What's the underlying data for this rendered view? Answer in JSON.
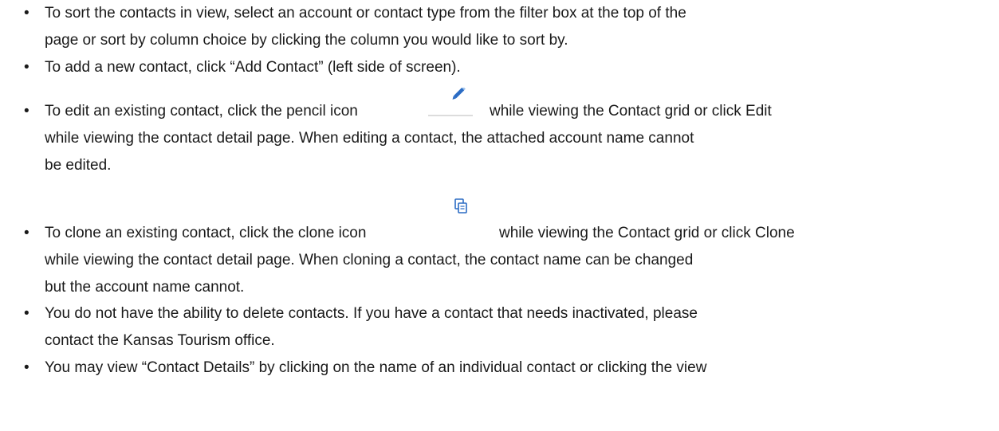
{
  "bullet_glyph": "•",
  "items": [
    {
      "lines": [
        "To sort the contacts in view, select an account or contact type from the filter box at the top of the",
        "page or sort by column choice by clicking the column you would like to sort by."
      ]
    },
    {
      "lines": [
        "To add a new contact, click “Add Contact” (left side of screen)."
      ]
    },
    {
      "lines": [
        "To edit an existing contact, click the pencil icon",
        "while viewing the Contact grid or click Edit",
        "while viewing the contact detail page. When editing a contact, the attached account name cannot",
        "be edited."
      ],
      "icon": "pencil-icon"
    },
    {
      "lines": [
        "To clone an existing contact, click the clone icon",
        "while viewing the Contact grid or click Clone",
        "while viewing the contact detail page. When cloning a contact, the contact name can be changed",
        "but the account name cannot."
      ],
      "icon": "clone-icon"
    },
    {
      "lines": [
        "You do not have the ability to delete contacts. If you have a contact that needs inactivated, please",
        "contact the Kansas Tourism office."
      ]
    },
    {
      "lines": [
        "You may view “Contact Details” by clicking on the name of an individual contact or clicking the view"
      ]
    }
  ],
  "colors": {
    "text": "#1a1a1a",
    "icon_blue": "#2b6cc4"
  }
}
